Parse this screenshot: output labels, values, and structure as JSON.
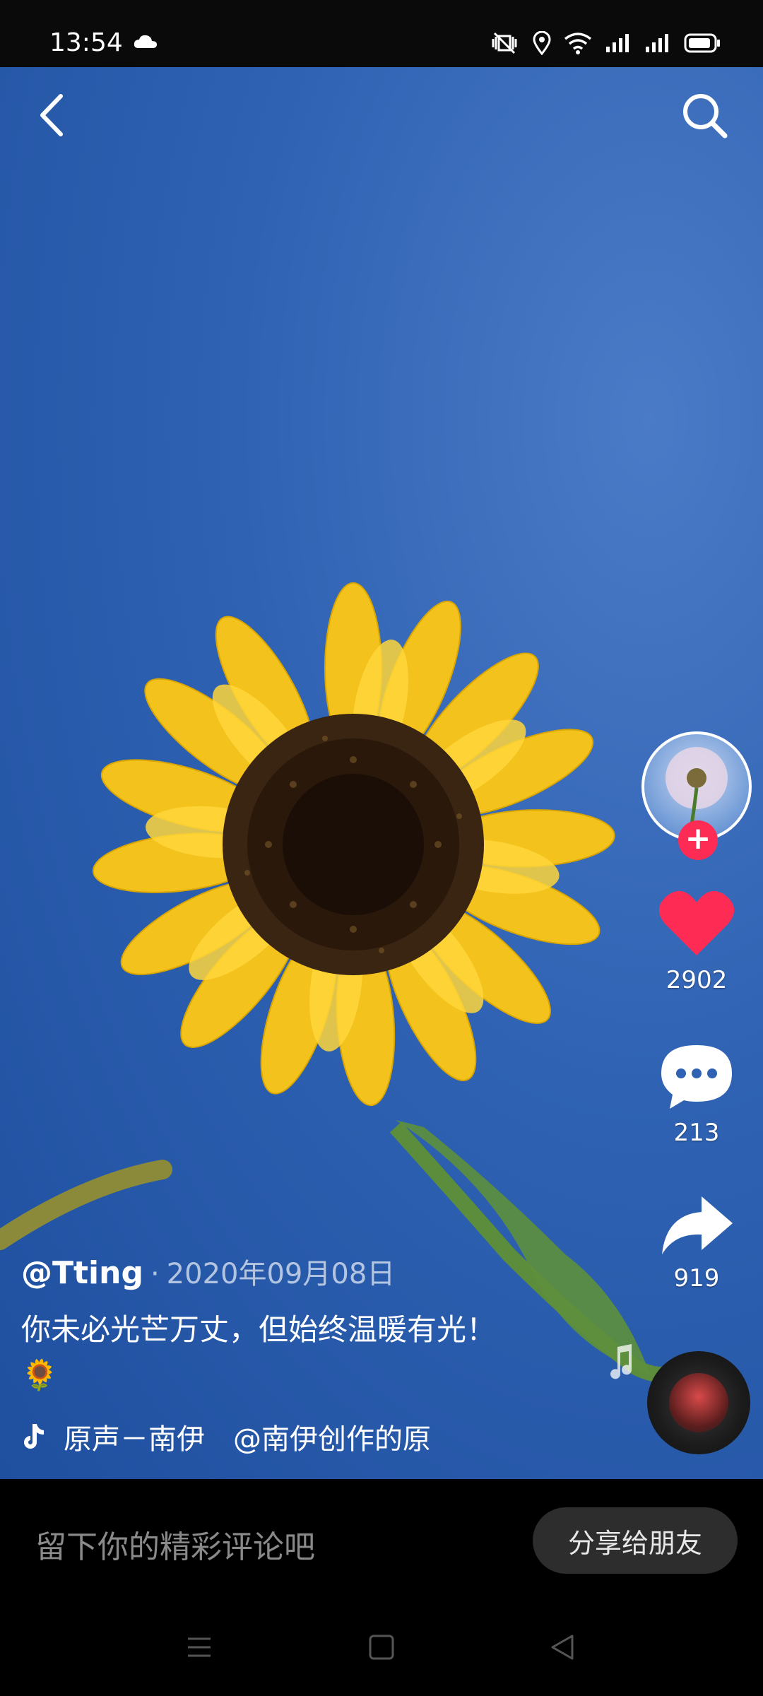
{
  "status_bar": {
    "time": "13:54"
  },
  "video": {
    "author": "@Tting",
    "separator": "·",
    "date": "2020年09月08日",
    "description": "你未必光芒万丈，但始终温暖有光！",
    "emoji": "🌻",
    "music": "原声－南伊　@南伊创作的原声"
  },
  "actions": {
    "likes": "2902",
    "comments": "213",
    "shares": "919"
  },
  "bottom": {
    "comment_placeholder": "留下你的精彩评论吧",
    "share_label": "分享给朋友"
  },
  "colors": {
    "like": "#fe2c55",
    "follow": "#fe2c55",
    "sky": "#2f62b3"
  }
}
